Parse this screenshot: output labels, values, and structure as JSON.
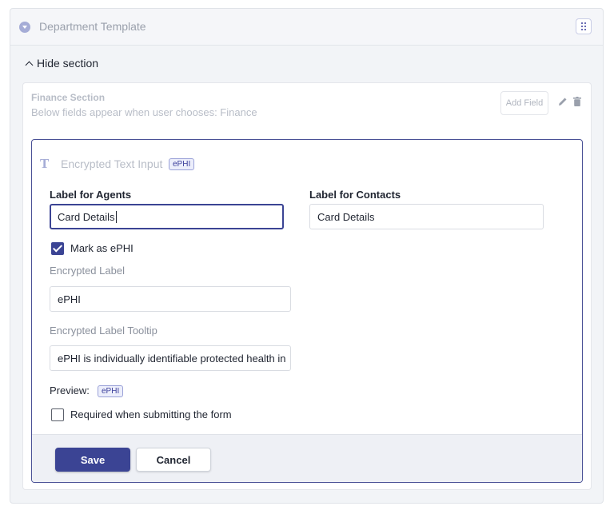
{
  "header": {
    "title": "Department Template",
    "menu_icon": "grid-dots-icon"
  },
  "toggle": {
    "label": "Hide section"
  },
  "section": {
    "title": "Finance Section",
    "subtitle": "Below fields appear when user chooses: Finance",
    "add_field_label": "Add Field"
  },
  "field": {
    "type_icon": "text-type-icon",
    "title": "Encrypted Text Input",
    "badge": "ePHI",
    "label_agents": "Label for Agents",
    "agents_value": "Card Details",
    "label_contacts": "Label for Contacts",
    "contacts_value": "Card Details",
    "mark_ephi_label": "Mark as ePHI",
    "mark_ephi_checked": true,
    "encrypted_label_title": "Encrypted Label",
    "encrypted_label_value": "ePHI",
    "tooltip_title": "Encrypted Label Tooltip",
    "tooltip_value": "ePHI is individually identifiable protected health in",
    "preview_label": "Preview:",
    "preview_badge": "ePHI",
    "required_label": "Required when submitting the form",
    "required_checked": false
  },
  "actions": {
    "save": "Save",
    "cancel": "Cancel"
  },
  "colors": {
    "primary": "#3b4494",
    "badge_bg": "#eceefb",
    "muted_text": "#b8bdc7"
  }
}
